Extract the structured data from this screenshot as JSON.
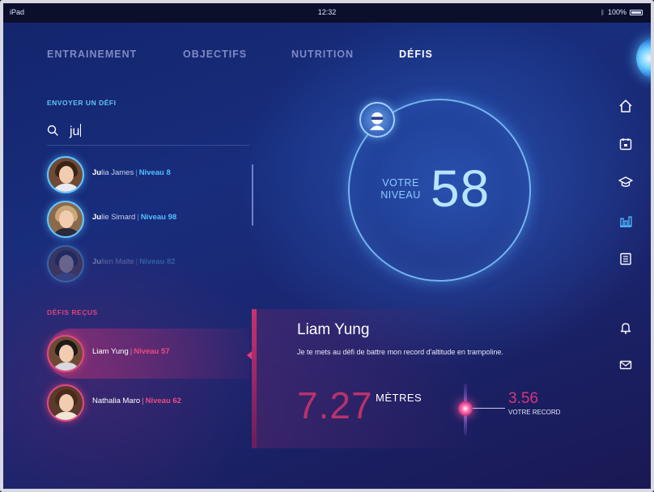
{
  "status_bar": {
    "device": "iPad",
    "time": "12:32",
    "battery": "100%"
  },
  "tabs": [
    {
      "label": "ENTRAINEMENT"
    },
    {
      "label": "OBJECTIFS"
    },
    {
      "label": "NUTRITION"
    },
    {
      "label": "DÉFIS",
      "active": true
    }
  ],
  "send": {
    "title": "ENVOYER UN DÉFI",
    "search_value": "ju",
    "results": [
      {
        "match": "Ju",
        "rest": "lia James",
        "level": "Niveau 8"
      },
      {
        "match": "Ju",
        "rest": "lie Simard",
        "level": "Niveau 98"
      },
      {
        "match": "Ju",
        "rest": "lien Malte",
        "level": "Niveau 82"
      }
    ]
  },
  "received": {
    "title": "DÉFIS REÇUS",
    "items": [
      {
        "name": "Liam Yung",
        "level": "Niveau 57",
        "selected": true
      },
      {
        "name": "Nathalia Maro",
        "level": "Niveau 62"
      }
    ]
  },
  "level": {
    "label_line1": "VOTRE",
    "label_line2": "NIVEAU",
    "value": "58"
  },
  "nav_icons": [
    "home-icon",
    "calendar-icon",
    "graduation-cap-icon",
    "bar-chart-icon",
    "document-icon",
    "bell-icon",
    "mail-icon"
  ],
  "challenge": {
    "name": "Liam Yung",
    "message": "Je te mets au défi de battre mon record d'altitude en trampoline.",
    "value": "7.27",
    "unit": "MÈTRES",
    "record_value": "3.56",
    "record_label": "VOTRE RECORD"
  },
  "colors": {
    "accent_blue": "#4fc0ff",
    "accent_pink": "#e0417a",
    "background": "#182d7c"
  }
}
